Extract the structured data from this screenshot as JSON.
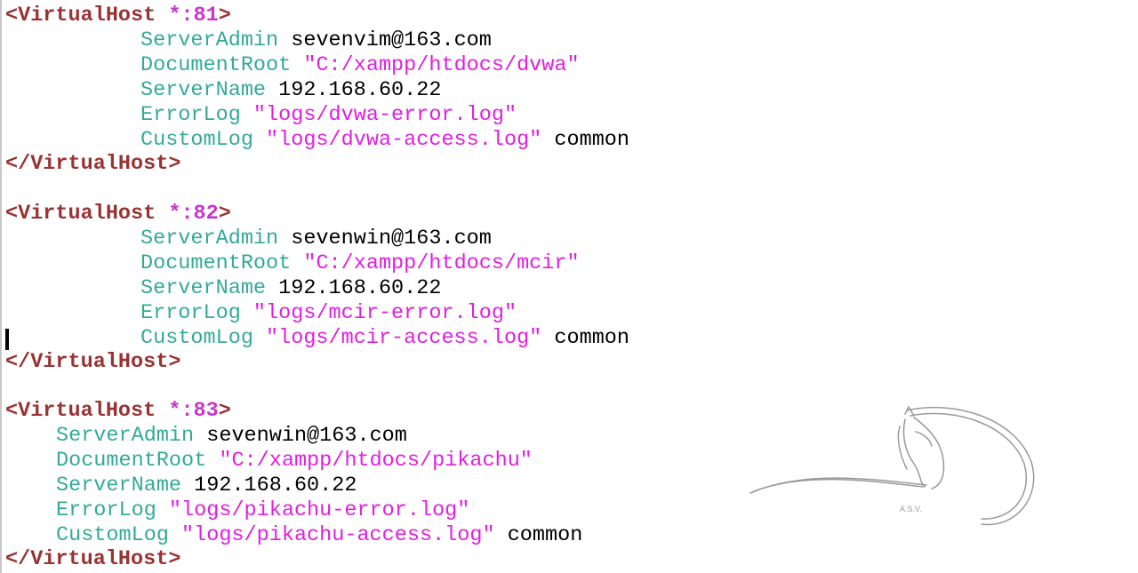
{
  "blocks": [
    {
      "open_tag": "<VirtualHost",
      "port": " *:81",
      "close_bracket": ">",
      "server_admin_key": "ServerAdmin",
      "server_admin_val": " sevenvim@163.com",
      "document_root_key": "DocumentRoot",
      "document_root_val": " \"C:/xampp/htdocs/dvwa\"",
      "server_name_key": "ServerName",
      "server_name_val": " 192.168.60.22",
      "error_log_key": "ErrorLog",
      "error_log_val": " \"logs/dvwa-error.log\"",
      "custom_log_key": "CustomLog",
      "custom_log_val": " \"logs/dvwa-access.log\"",
      "custom_log_format": " common",
      "close_tag": "</VirtualHost>"
    },
    {
      "open_tag": "<VirtualHost",
      "port": " *:82",
      "close_bracket": ">",
      "server_admin_key": "ServerAdmin",
      "server_admin_val": " sevenwin@163.com",
      "document_root_key": "DocumentRoot",
      "document_root_val": " \"C:/xampp/htdocs/mcir\"",
      "server_name_key": "ServerName",
      "server_name_val": " 192.168.60.22",
      "error_log_key": "ErrorLog",
      "error_log_val": " \"logs/mcir-error.log\"",
      "custom_log_key": "CustomLog",
      "custom_log_val": " \"logs/mcir-access.log\"",
      "custom_log_format": " common",
      "close_tag": "</VirtualHost>"
    },
    {
      "open_tag": "<VirtualHost",
      "port": " *:83",
      "close_bracket": ">",
      "server_admin_key": "ServerAdmin",
      "server_admin_val": " sevenwin@163.com",
      "document_root_key": "DocumentRoot",
      "document_root_val": " \"C:/xampp/htdocs/pikachu\"",
      "server_name_key": "ServerName",
      "server_name_val": " 192.168.60.22",
      "error_log_key": "ErrorLog",
      "error_log_val": " \"logs/pikachu-error.log\"",
      "custom_log_key": "CustomLog",
      "custom_log_val": " \"logs/pikachu-access.log\"",
      "custom_log_format": " common",
      "close_tag": "</VirtualHost>"
    }
  ],
  "watermark": {
    "icon": "horse-head-logo",
    "text": "A.S.V."
  },
  "colors": {
    "tag": "#993333",
    "directive": "#33aa99",
    "string": "#e020e0",
    "value": "#000000"
  }
}
